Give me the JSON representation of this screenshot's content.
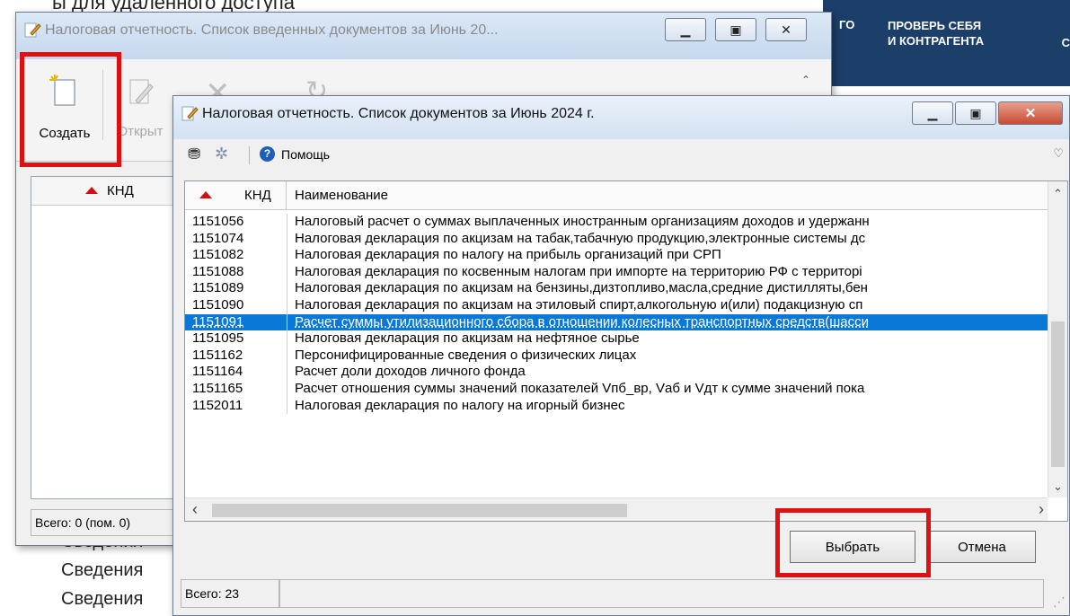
{
  "web": {
    "top_text": "ы для удаленного доступа",
    "banner_left": "ГО",
    "banner_main": "ПРОВЕРЬ СЕБЯ\nИ КОНТРАГЕНТА",
    "banner_right": "С",
    "sved": "Сведения",
    "banner_color": "#1b3f69"
  },
  "win1": {
    "title": "Налоговая отчетность. Список введенных документов за Июнь 20...",
    "toolbar": {
      "create_label": "Создать",
      "open_label": "Открыт"
    },
    "grid_header_knd": "КНД",
    "status": "Всего: 0 (пом. 0)"
  },
  "win2": {
    "title": "Налоговая отчетность. Список документов за Июнь 2024 г.",
    "help_label": "Помощь",
    "columns": {
      "knd": "КНД",
      "name": "Наименование"
    },
    "rows": [
      {
        "knd": "1151056",
        "name": "Налоговый расчет о суммах выплаченных иностранным организациям доходов и удержанн"
      },
      {
        "knd": "1151074",
        "name": "Налоговая декларация по акцизам на табак,табачную продукцию,электронные системы дс"
      },
      {
        "knd": "1151082",
        "name": "Налоговая декларация по налогу на прибыль организаций при СРП"
      },
      {
        "knd": "1151088",
        "name": "Налоговая декларация по косвенным налогам при импорте на территорию РФ с территорі"
      },
      {
        "knd": "1151089",
        "name": "Налоговая декларация по акцизам на бензины,дизтопливо,масла,средние дистилляты,бен"
      },
      {
        "knd": "1151090",
        "name": "Налоговая декларация по акцизам на этиловый спирт,алкогольную и(или) подакцизную сп"
      },
      {
        "knd": "1151091",
        "name": "Расчет суммы утилизационного сбора в отношении колесных транспортных средств(шасси",
        "selected": true
      },
      {
        "knd": "1151095",
        "name": "Налоговая декларация по акцизам на нефтяное сырье"
      },
      {
        "knd": "1151162",
        "name": "Персонифицированные сведения о физических лицах"
      },
      {
        "knd": "1151164",
        "name": "Расчет доли доходов личного фонда"
      },
      {
        "knd": "1151165",
        "name": "Расчет отношения суммы значений показателей Vпб_вр, Vаб и Vдт к сумме значений пока"
      },
      {
        "knd": "1152011",
        "name": "Налоговая декларация по налогу на игорный бизнес"
      }
    ],
    "select_button": "Выбрать",
    "cancel_button": "Отмена",
    "status": "Всего: 23",
    "selection_color": "#0a78d7",
    "highlight_color": "#e01010"
  }
}
